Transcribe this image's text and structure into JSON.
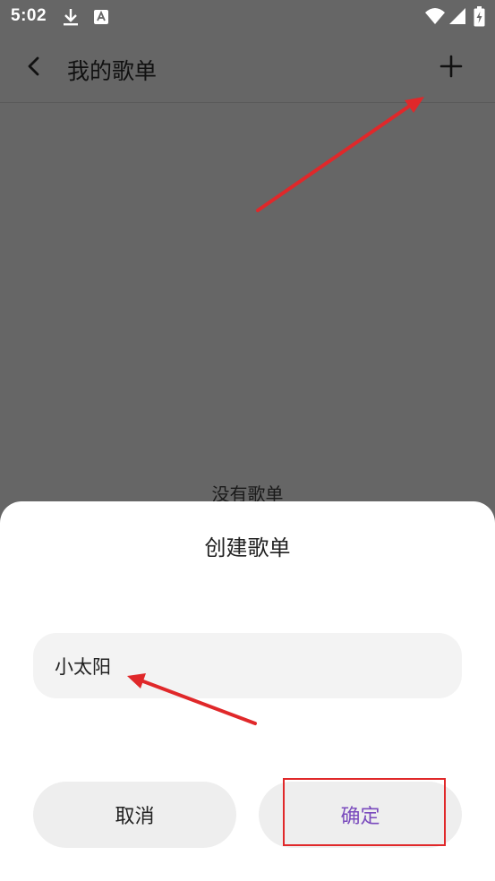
{
  "status_bar": {
    "time": "5:02"
  },
  "app_bar": {
    "title": "我的歌单"
  },
  "empty_state": {
    "text": "没有歌单"
  },
  "dialog": {
    "title": "创建歌单",
    "input_value": "小太阳",
    "cancel_label": "取消",
    "confirm_label": "确定"
  },
  "colors": {
    "scrim": "#666666",
    "accent": "#7a4bbd",
    "annotation_red": "#e0282a"
  },
  "icons": {
    "back": "back-arrow-icon",
    "add": "plus-icon",
    "download": "download-icon",
    "notification": "text-app-icon",
    "wifi": "wifi-icon",
    "signal": "cell-signal-icon",
    "battery": "battery-charging-icon"
  }
}
